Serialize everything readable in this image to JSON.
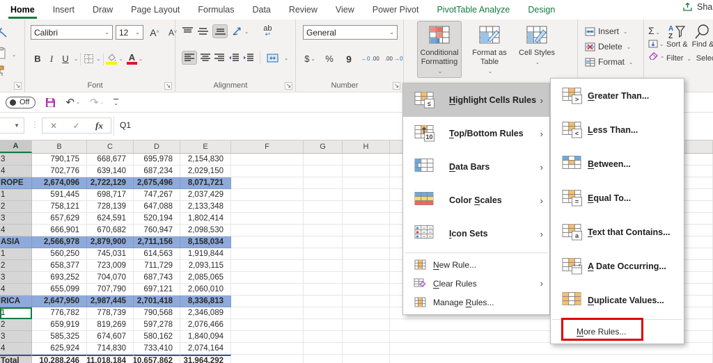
{
  "app": {
    "tabs": [
      {
        "label": "Home",
        "state": "active"
      },
      {
        "label": "Insert",
        "state": "normal"
      },
      {
        "label": "Draw",
        "state": "normal"
      },
      {
        "label": "Page Layout",
        "state": "normal"
      },
      {
        "label": "Formulas",
        "state": "normal"
      },
      {
        "label": "Data",
        "state": "normal"
      },
      {
        "label": "Review",
        "state": "normal"
      },
      {
        "label": "View",
        "state": "normal"
      },
      {
        "label": "Power Pivot",
        "state": "normal"
      },
      {
        "label": "PivotTable Analyze",
        "state": "contextual"
      },
      {
        "label": "Design",
        "state": "contextual"
      }
    ],
    "share_label": "Share"
  },
  "quick_access": {
    "autosave_label": "Off"
  },
  "ribbon": {
    "font_group": {
      "label": "Font",
      "font_name": "Calibri",
      "font_size": "12",
      "bold": "B",
      "italic": "I",
      "underline": "U",
      "grow_glyph": "A",
      "shrink_glyph": "A"
    },
    "alignment_group": {
      "label": "Alignment",
      "wrap_glyph": "ab"
    },
    "number_group": {
      "label": "Number",
      "format": "General",
      "currency": "$",
      "percent": "%",
      "comma": "9",
      "inc_dec": ".00",
      "dec_dec": ".00"
    },
    "styles_group": {
      "conditional_formatting": "Conditional Formatting",
      "format_as_table": "Format as Table",
      "cell_styles": "Cell Styles"
    },
    "cells_group": {
      "insert": "Insert",
      "delete": "Delete",
      "format": "Format"
    },
    "editing_group": {
      "autosum": "Σ",
      "sort_filter": "Sort & Filter",
      "find_select": "Find & Select"
    }
  },
  "formula_bar": {
    "fx_label": "fx",
    "cancel_glyph": "✕",
    "enter_glyph": "✓",
    "value": "Q1"
  },
  "sheet": {
    "column_headers": [
      "A",
      "B",
      "C",
      "D",
      "E",
      "F",
      "G",
      "H",
      ""
    ],
    "rows": [
      {
        "a": "3",
        "type": "data",
        "vals": [
          "790,175",
          "668,677",
          "695,978",
          "2,154,830"
        ]
      },
      {
        "a": "4",
        "type": "data",
        "vals": [
          "702,776",
          "639,140",
          "687,234",
          "2,029,150"
        ]
      },
      {
        "a": "ROPE",
        "type": "region",
        "vals": [
          "2,674,096",
          "2,722,129",
          "2,675,496",
          "8,071,721"
        ]
      },
      {
        "a": "1",
        "type": "data",
        "vals": [
          "591,445",
          "698,717",
          "747,267",
          "2,037,429"
        ]
      },
      {
        "a": "2",
        "type": "data",
        "vals": [
          "758,121",
          "728,139",
          "647,088",
          "2,133,348"
        ]
      },
      {
        "a": "3",
        "type": "data",
        "vals": [
          "657,629",
          "624,591",
          "520,194",
          "1,802,414"
        ]
      },
      {
        "a": "4",
        "type": "data",
        "vals": [
          "666,901",
          "670,682",
          "760,947",
          "2,098,530"
        ]
      },
      {
        "a": "ASIA",
        "type": "region",
        "vals": [
          "2,566,978",
          "2,879,900",
          "2,711,156",
          "8,158,034"
        ]
      },
      {
        "a": "1",
        "type": "data",
        "vals": [
          "560,250",
          "745,031",
          "614,563",
          "1,919,844"
        ]
      },
      {
        "a": "2",
        "type": "data",
        "vals": [
          "658,377",
          "723,009",
          "711,729",
          "2,093,115"
        ]
      },
      {
        "a": "3",
        "type": "data",
        "vals": [
          "693,252",
          "704,070",
          "687,743",
          "2,085,065"
        ]
      },
      {
        "a": "4",
        "type": "data",
        "vals": [
          "655,099",
          "707,790",
          "697,121",
          "2,060,010"
        ]
      },
      {
        "a": "RICA",
        "type": "region",
        "vals": [
          "2,647,950",
          "2,987,445",
          "2,701,418",
          "8,336,813"
        ]
      },
      {
        "a": "1",
        "type": "active",
        "vals": [
          "776,782",
          "778,739",
          "790,568",
          "2,346,089"
        ]
      },
      {
        "a": "2",
        "type": "data",
        "vals": [
          "659,919",
          "819,269",
          "597,278",
          "2,076,466"
        ]
      },
      {
        "a": "3",
        "type": "data",
        "vals": [
          "585,325",
          "674,607",
          "580,162",
          "1,840,094"
        ]
      },
      {
        "a": "4",
        "type": "data",
        "vals": [
          "625,924",
          "714,830",
          "733,410",
          "2,074,164"
        ]
      },
      {
        "a": "Total",
        "type": "total",
        "vals": [
          "10,288,246",
          "11,018,184",
          "10,657,862",
          "31,964,292"
        ]
      }
    ]
  },
  "cf_menu": {
    "items": [
      {
        "label": "Highlight Cells Rules",
        "u": 0,
        "icon": "highlight-cells-rules",
        "size": "big",
        "chevron": true,
        "state": "hover"
      },
      {
        "label": "Top/Bottom Rules",
        "u": 0,
        "icon": "top-bottom-rules",
        "size": "big",
        "chevron": true
      },
      {
        "label": "Data Bars",
        "u": 0,
        "icon": "data-bars",
        "size": "big",
        "chevron": true
      },
      {
        "label": "Color Scales",
        "u": 6,
        "icon": "color-scales",
        "size": "big",
        "chevron": true
      },
      {
        "label": "Icon Sets",
        "u": 0,
        "icon": "icon-sets",
        "size": "big",
        "chevron": true,
        "sep_after": true
      },
      {
        "label": "New Rule...",
        "u": 0,
        "icon": "new-rule",
        "size": "small"
      },
      {
        "label": "Clear Rules",
        "u": 0,
        "icon": "clear-rules",
        "size": "small",
        "chevron": true
      },
      {
        "label": "Manage Rules...",
        "u": 7,
        "icon": "manage-rules",
        "size": "small"
      }
    ]
  },
  "hcr_submenu": {
    "items": [
      {
        "label": "Greater Than...",
        "u": 0,
        "icon": "greater-than",
        "size": "big"
      },
      {
        "label": "Less Than...",
        "u": 0,
        "icon": "less-than",
        "size": "big"
      },
      {
        "label": "Between...",
        "u": 0,
        "icon": "between",
        "size": "big"
      },
      {
        "label": "Equal To...",
        "u": 0,
        "icon": "equal-to",
        "size": "big"
      },
      {
        "label": "Text that Contains...",
        "u": 0,
        "icon": "text-that-contains",
        "size": "big"
      },
      {
        "label": "A Date Occurring...",
        "u": 0,
        "icon": "a-date-occurring",
        "size": "big"
      },
      {
        "label": "Duplicate Values...",
        "u": 0,
        "icon": "duplicate-values",
        "size": "big",
        "sep_after": true
      },
      {
        "label": "More Rules...",
        "u": 0,
        "icon": "",
        "size": "small",
        "annotated": true
      }
    ]
  },
  "colors": {
    "excel_green": "#107C41",
    "region_row_blue": "#8EAADB",
    "column_a_gray": "#D6D6D6",
    "menu_hover_gray": "#C8C8C8",
    "annotation_red": "#DE0000"
  }
}
